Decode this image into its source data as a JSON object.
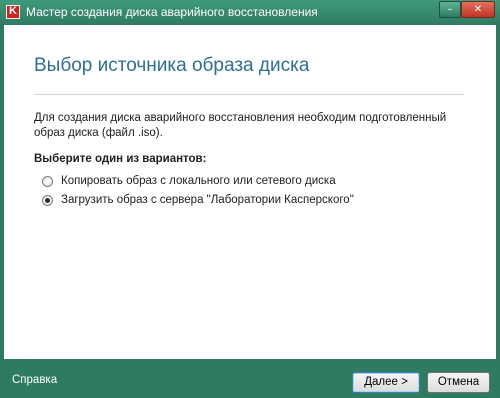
{
  "window": {
    "title": "Мастер создания диска аварийного восстановления",
    "minimize_glyph": "–",
    "close_glyph": "✕"
  },
  "page": {
    "heading": "Выбор источника образа диска",
    "description": "Для создания диска аварийного восстановления необходим подготовленный образ диска (файл .iso).",
    "options_label": "Выберите один из вариантов:",
    "options": [
      {
        "label": "Копировать образ с локального или сетевого диска",
        "selected": false
      },
      {
        "label": "Загрузить образ с сервера \"Лаборатории Касперского\"",
        "selected": true
      }
    ]
  },
  "footer": {
    "help_label": "Справка",
    "next_label": "Далее >",
    "cancel_label": "Отмена"
  },
  "colors": {
    "frame": "#2f7b62",
    "heading": "#2e6f93"
  }
}
